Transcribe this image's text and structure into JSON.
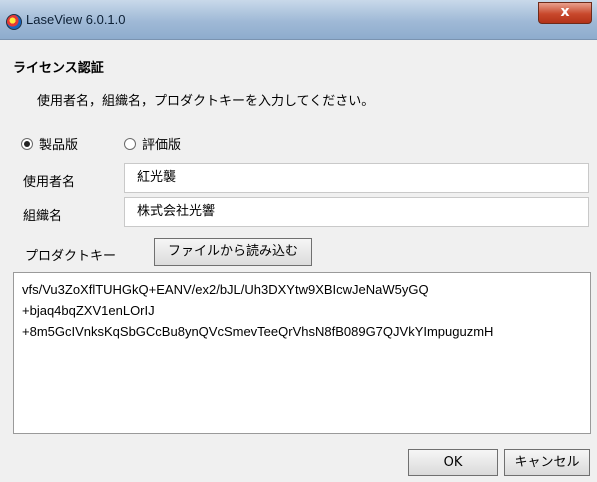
{
  "window": {
    "title": "LaseView 6.0.1.0",
    "close_glyph": "x"
  },
  "dialog": {
    "heading": "ライセンス認証",
    "instruction": "使用者名，組織名，プロダクトキーを入力してください。"
  },
  "edition": {
    "selected": "製品版",
    "options": [
      {
        "label": "製品版",
        "checked": true
      },
      {
        "label": "評価版",
        "checked": false
      }
    ]
  },
  "fields": {
    "user_label": "使用者名",
    "user_value": "紅光襲",
    "org_label": "組織名",
    "org_value": "株式会社光響"
  },
  "product_key": {
    "label": "プロダクトキー",
    "load_button": "ファイルから読み込む",
    "lines": [
      "vfs/Vu3ZoXflTUHGkQ+EANV/ex2/bJL/Uh3DXYtw9XBIcwJeNaW5yGQ",
      "+bjaq4bqZXV1enLOrIJ",
      "+8m5GcIVnksKqSbGCcBu8ynQVcSmevTeeQrVhsN8fB089G7QJVkYImpuguzmH"
    ]
  },
  "buttons": {
    "ok": "OK",
    "cancel": "キャンセル"
  },
  "icons": {
    "app": "laseview-app-icon",
    "close": "close-icon"
  }
}
